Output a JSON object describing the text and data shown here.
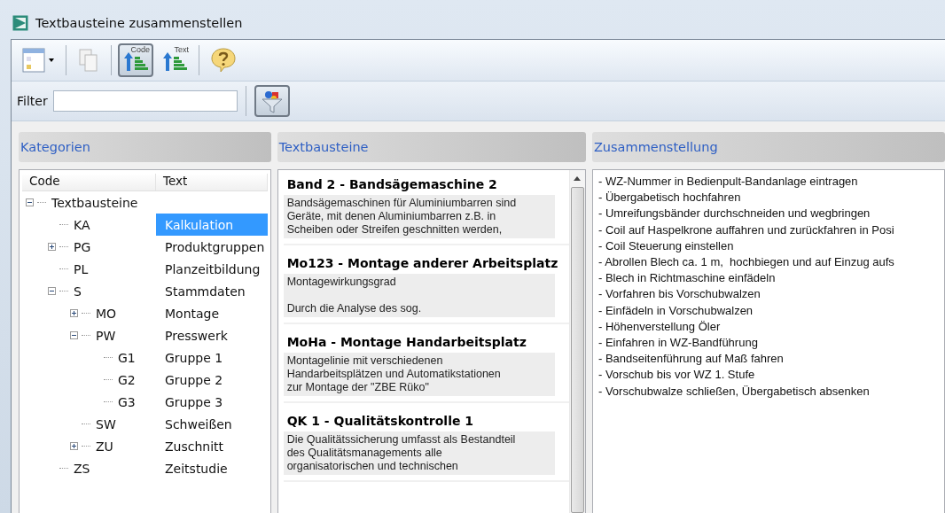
{
  "window": {
    "title": "Textbausteine zusammenstellen"
  },
  "toolbar": [
    {
      "kind": "menu"
    },
    {
      "kind": "copy"
    },
    {
      "kind": "sort",
      "label": "Code",
      "selected": true
    },
    {
      "kind": "sort",
      "label": "Text",
      "selected": false
    },
    {
      "kind": "help"
    }
  ],
  "filter": {
    "label": "Filter"
  },
  "categories": {
    "title": "Kategorien",
    "columns": [
      "Code",
      "Text"
    ],
    "tree": [
      {
        "code": "Textbausteine",
        "expanded": true,
        "selected": false,
        "children": [
          {
            "code": "KA",
            "text": "Kalkulation",
            "selected": true
          },
          {
            "code": "PG",
            "text": "Produktgruppen",
            "expanded": false,
            "selected": false
          },
          {
            "code": "PL",
            "text": "Planzeitbildung",
            "selected": false
          },
          {
            "code": "S",
            "text": "Stammdaten",
            "expanded": true,
            "selected": false,
            "children": [
              {
                "code": "MO",
                "text": "Montage",
                "expanded": false,
                "selected": false
              },
              {
                "code": "PW",
                "text": "Presswerk",
                "expanded": true,
                "selected": false,
                "children": [
                  {
                    "code": "G1",
                    "text": "Gruppe 1",
                    "selected": false
                  },
                  {
                    "code": "G2",
                    "text": "Gruppe 2",
                    "selected": false
                  },
                  {
                    "code": "G3",
                    "text": "Gruppe 3",
                    "selected": false
                  }
                ]
              },
              {
                "code": "SW",
                "text": "Schweißen",
                "selected": false
              },
              {
                "code": "ZU",
                "text": "Zuschnitt",
                "expanded": false,
                "selected": false
              }
            ]
          },
          {
            "code": "ZS",
            "text": "Zeitstudie",
            "selected": false
          }
        ]
      }
    ]
  },
  "textbausteine": {
    "title": "Textbausteine",
    "items": [
      {
        "title": "Band 2 - Bandsägemaschine 2",
        "body": "Bandsägemaschinen für Aluminiumbarren sind\nGeräte, mit denen Aluminiumbarren z.B. in\nScheiben oder Streifen geschnitten werden,"
      },
      {
        "title": "Mo123 - Montage anderer Arbeitsplatz",
        "body": "Montagewirkungsgrad\n\nDurch die Analyse des sog."
      },
      {
        "title": "MoHa - Montage Handarbeitsplatz",
        "body": "Montagelinie mit verschiedenen\nHandarbeitsplätzen und Automatikstationen\nzur Montage der \"ZBE Rüko\""
      },
      {
        "title": "QK 1 - Qualitätskontrolle 1",
        "body": "Die Qualitätssicherung umfasst als Bestandteil\ndes Qualitätsmanagements alle\norganisatorischen und technischen"
      }
    ]
  },
  "zusammenstellung": {
    "title": "Zusammenstellung",
    "lines": [
      "- WZ-Nummer in Bedienpult-Bandanlage eintragen",
      "- Übergabetisch hochfahren",
      "- Umreifungsbänder durchschneiden und wegbringen",
      "- Coil auf Haspelkrone auffahren und zurückfahren in Posi",
      "- Coil Steuerung einstellen",
      "- Abrollen Blech ca. 1 m,  hochbiegen und auf Einzug aufs",
      "- Blech in Richtmaschine einfädeln",
      "- Vorfahren bis Vorschubwalzen",
      "- Einfädeln in Vorschubwalzen",
      "- Höhenverstellung Öler",
      "- Einfahren in WZ-Bandführung",
      "- Bandseitenführung auf Maß fahren",
      "- Vorschub bis vor WZ 1. Stufe",
      "- Vorschubwalze schließen, Übergabetisch absenken"
    ]
  }
}
